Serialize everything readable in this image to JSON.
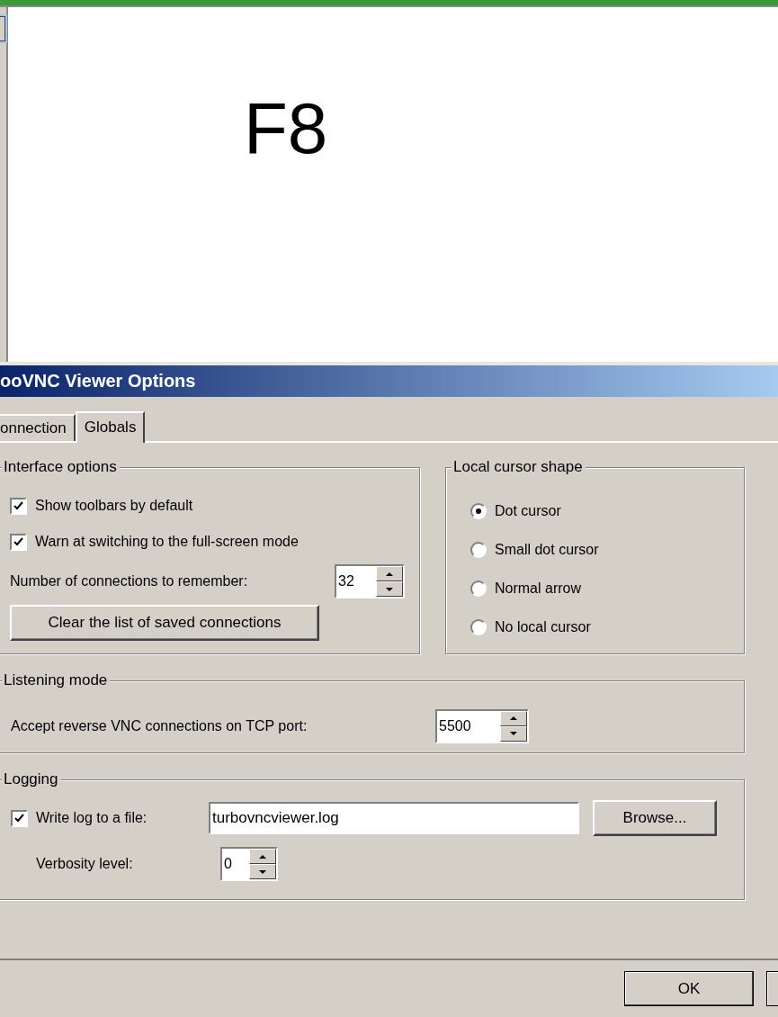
{
  "background": {
    "label": "F8"
  },
  "dialog": {
    "title": "ooVNC Viewer Options",
    "tabs": [
      {
        "label": "onnection",
        "selected": false
      },
      {
        "label": "Globals",
        "selected": true
      }
    ],
    "interface_options": {
      "title": "Interface options",
      "checkboxes": [
        {
          "label": "Show toolbars by default",
          "checked": true
        },
        {
          "label": "Warn at switching to the full-screen mode",
          "checked": true
        }
      ],
      "connections_label": "Number of connections to remember:",
      "connections_value": "32",
      "clear_button": "Clear the list of saved connections"
    },
    "cursor_shape": {
      "title": "Local cursor shape",
      "options": [
        {
          "label": "Dot cursor",
          "selected": true
        },
        {
          "label": "Small dot cursor",
          "selected": false
        },
        {
          "label": "Normal arrow",
          "selected": false
        },
        {
          "label": "No local cursor",
          "selected": false
        }
      ]
    },
    "listening": {
      "title": "Listening mode",
      "label": "Accept reverse VNC connections on TCP port:",
      "port": "5500"
    },
    "logging": {
      "title": "Logging",
      "write_log": {
        "label": "Write log to a file:",
        "checked": true
      },
      "file": "turbovncviewer.log",
      "browse_button": "Browse...",
      "verbosity_label": "Verbosity level:",
      "verbosity": "0"
    },
    "buttons": [
      "OK"
    ]
  }
}
